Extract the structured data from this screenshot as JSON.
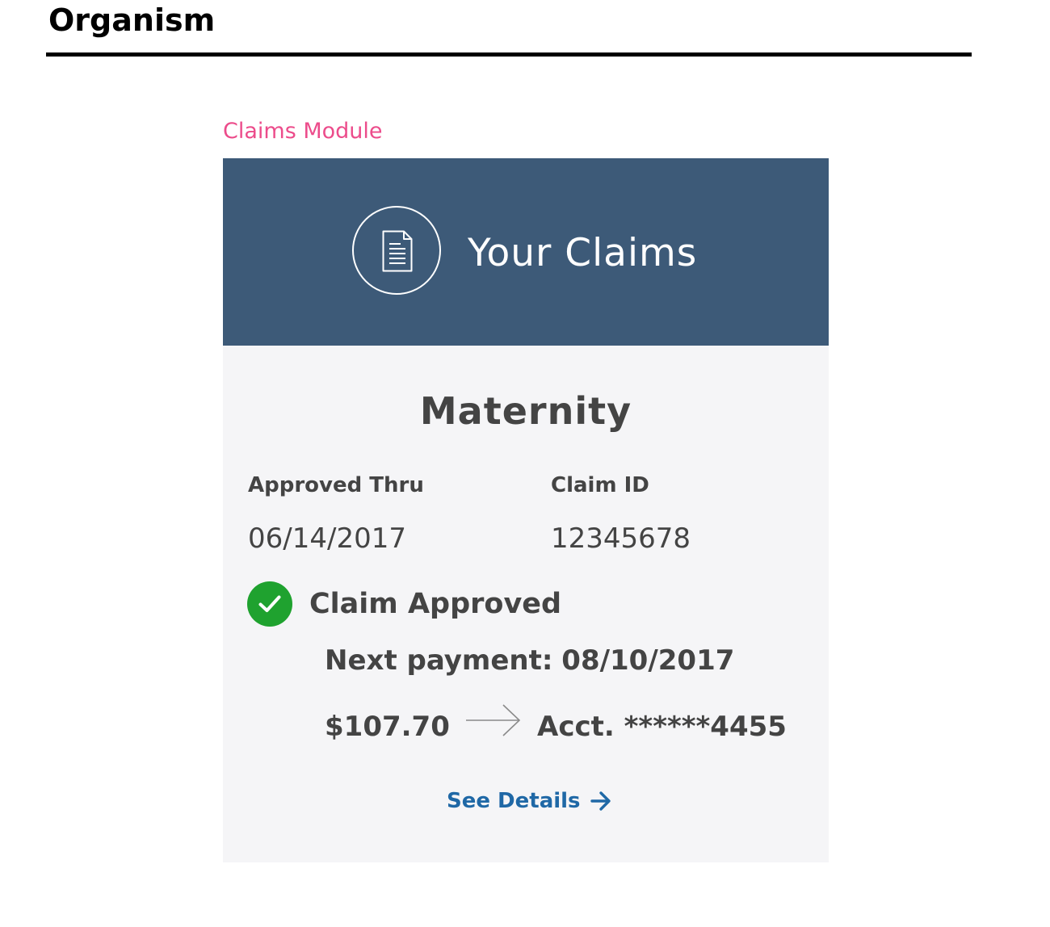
{
  "page": {
    "title": "Organism"
  },
  "module": {
    "label": "Claims Module"
  },
  "card": {
    "header_title": "Your Claims",
    "header_icon": "document-icon",
    "claim_type": "Maternity",
    "fields": {
      "approved_thru_label": "Approved Thru",
      "approved_thru_value": "06/14/2017",
      "claim_id_label": "Claim ID",
      "claim_id_value": "12345678"
    },
    "status": {
      "icon": "check-circle-icon",
      "text": "Claim Approved",
      "color": "#1fa22f"
    },
    "payment": {
      "next_label": "Next payment:",
      "next_date": "08/10/2017",
      "amount": "$107.70",
      "account": "Acct. ******4455"
    },
    "link": {
      "label": "See Details",
      "icon": "arrow-right-icon"
    }
  },
  "colors": {
    "header_bg": "#3d5a78",
    "card_bg": "#f5f5f7",
    "module_label": "#ec4c8b",
    "link": "#1f68a6",
    "text": "#444444"
  }
}
